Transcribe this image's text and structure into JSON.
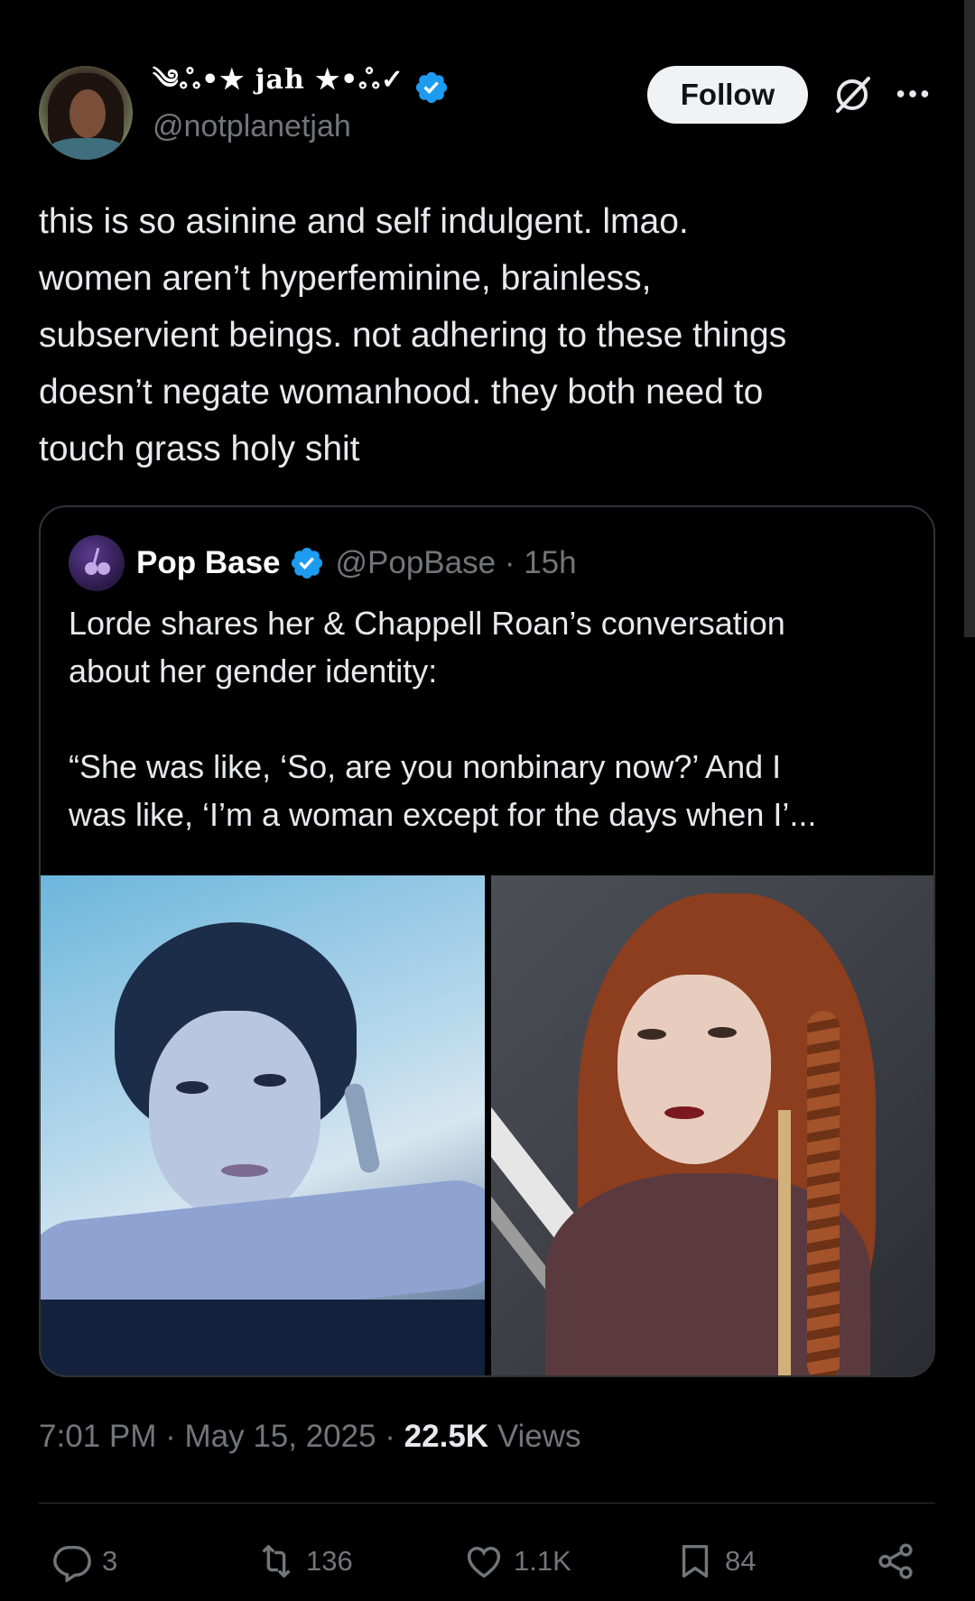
{
  "author": {
    "display_name": "༄ஃ•★ jah ★•ஃ✓",
    "handle": "@notplanetjah",
    "verified": true
  },
  "header": {
    "follow_label": "Follow",
    "grok_icon": "grok-icon",
    "more_icon": "more-icon"
  },
  "tweet": {
    "text": "this is so asinine and self indulgent. lmao.\nwomen aren’t hyperfeminine, brainless,\nsubservient beings. not adhering to these things\ndoesn’t negate womanhood. they both need to\ntouch grass holy shit"
  },
  "quote": {
    "name": "Pop Base",
    "handle": "@PopBase",
    "time": "15h",
    "text": "Lorde shares her & Chappell Roan’s conversation\nabout her gender identity:\n\n“She was like, ‘So, are you nonbinary now?’ And I\nwas like, ‘I’m a woman except for the days when I’...",
    "images": [
      "lorde-photo",
      "chappell-roan-photo"
    ]
  },
  "meta": {
    "time": "7:01 PM",
    "date": "May 15, 2025",
    "views_count": "22.5K",
    "views_label": "Views",
    "separator": " · "
  },
  "actions": {
    "replies": "3",
    "reposts": "136",
    "likes": "1.1K",
    "bookmarks": "84"
  },
  "colors": {
    "background": "#000000",
    "text": "#e7e9ea",
    "muted": "#71767b",
    "verified": "#1d9bf0",
    "border": "#2f3336"
  }
}
